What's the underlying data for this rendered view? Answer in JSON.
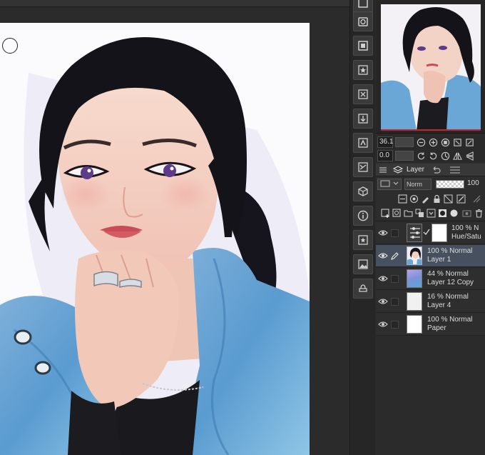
{
  "navigator": {
    "zoom": "36.1",
    "rotation": "0.0"
  },
  "layer_panel": {
    "tab_label": "Layer",
    "blend_mode": "Norm",
    "opacity": "100"
  },
  "layers": [
    {
      "opacity_mode": "100 % N",
      "name": "Hue/Satu",
      "kind": "correction"
    },
    {
      "opacity_mode": "100 % Normal",
      "name": "Layer 1",
      "kind": "painting",
      "selected": true
    },
    {
      "opacity_mode": "44 % Normal",
      "name": "Layer 12 Copy",
      "kind": "gradient"
    },
    {
      "opacity_mode": "16 % Normal",
      "name": "Layer 4",
      "kind": "light"
    },
    {
      "opacity_mode": "100 % Normal",
      "name": "Paper",
      "kind": "paper"
    }
  ],
  "colors": {
    "ui_dark": "#2b2b2b",
    "panel": "#2f2f2f",
    "selected_layer": "#46505e",
    "navigator_frame": "#c0282d"
  },
  "tool_icons": [
    "export-icon",
    "layer-property-icon",
    "frame-icon",
    "star-icon",
    "material-icon",
    "import-icon",
    "transform-icon",
    "adjust-icon",
    "3d-icon",
    "info-icon",
    "favorite-icon",
    "image-icon",
    "stamp-icon"
  ]
}
